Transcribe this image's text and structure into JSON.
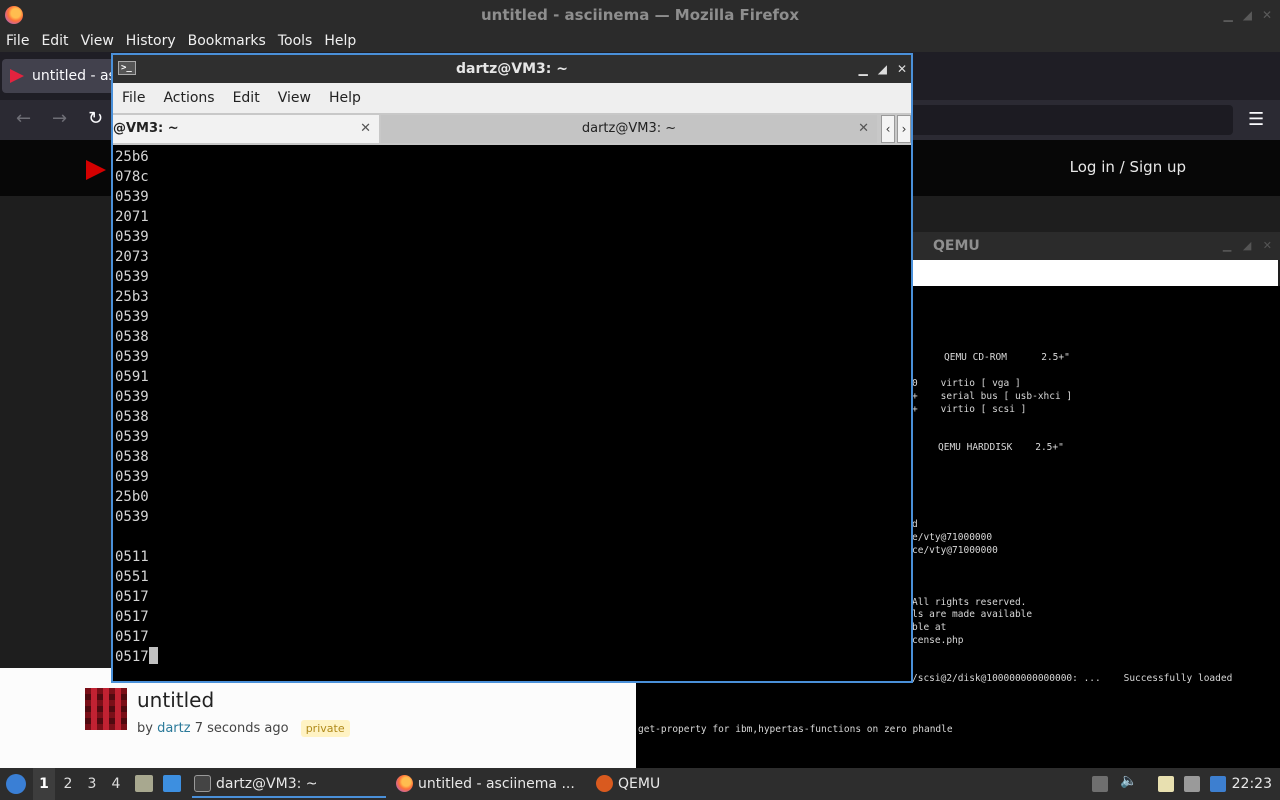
{
  "firefox": {
    "window_title": "untitled - asciinema — Mozilla Firefox",
    "menus": [
      "File",
      "Edit",
      "View",
      "History",
      "Bookmarks",
      "Tools",
      "Help"
    ],
    "tab_label": "untitled - as",
    "login_label": "Log in / Sign up",
    "recording": {
      "title": "untitled",
      "by_label": "by",
      "author": "dartz",
      "time_ago": "7 seconds ago",
      "badge": "private"
    }
  },
  "qemu": {
    "window_title": "QEMU",
    "screen_lines": [
      "QEMU CD-ROM      2.5+\"",
      "0    virtio [ vga ]",
      "+    serial bus [ usb-xhci ]",
      "+    virtio [ scsi ]",
      "QEMU HARDDISK    2.5+\"",
      "d",
      "e/vty@71000000",
      "ce/vty@71000000",
      "All rights reserved.",
      "ls are made available",
      "ble at",
      "cense.php",
      "/scsi@2/disk@100000000000000: ...    Successfully loaded",
      "get-property for ibm,hypertas-functions on zero phandle"
    ]
  },
  "terminal": {
    "window_title": "dartz@VM3: ~",
    "menus": [
      "File",
      "Actions",
      "Edit",
      "View",
      "Help"
    ],
    "tabs": [
      {
        "label": "@VM3: ~"
      },
      {
        "label": "dartz@VM3: ~"
      }
    ],
    "lines": [
      "25b6",
      "078c",
      "0539",
      "2071",
      "0539",
      "2073",
      "0539",
      "25b3",
      "0539",
      "0538",
      "0539",
      "0591",
      "0539",
      "0538",
      "0539",
      "0538",
      "0539",
      "25b0",
      "0539",
      "",
      "0511",
      "0551",
      "0517",
      "0517",
      "0517",
      "0517"
    ]
  },
  "taskbar": {
    "workspaces": [
      "1",
      "2",
      "3",
      "4"
    ],
    "tasks": [
      {
        "label": "dartz@VM3: ~"
      },
      {
        "label": "untitled - asciinema ..."
      },
      {
        "label": "QEMU"
      }
    ],
    "clock": "22:23"
  },
  "colors": {
    "accent": "#4a90d9",
    "brand_red": "#d40000"
  }
}
